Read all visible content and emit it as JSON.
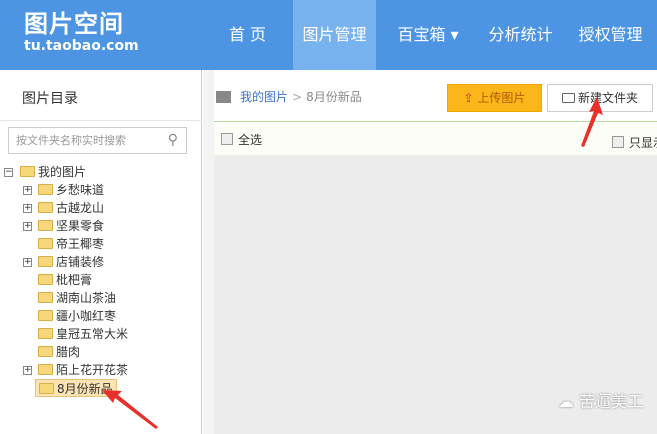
{
  "header": {
    "logo_title": "图片空间",
    "logo_url": "tu.taobao.com",
    "nav": [
      {
        "label": "首 页"
      },
      {
        "label": "图片管理",
        "active": true
      },
      {
        "label": "百宝箱 ▾"
      },
      {
        "label": "分析统计"
      },
      {
        "label": "授权管理"
      }
    ]
  },
  "sidebar": {
    "title": "图片目录",
    "search_placeholder": "按文件夹名称实时搜索",
    "root": "我的图片",
    "folders": [
      {
        "label": "乡愁味道",
        "expandable": true
      },
      {
        "label": "古越龙山",
        "expandable": true
      },
      {
        "label": "坚果零食",
        "expandable": true
      },
      {
        "label": "帝王椰枣",
        "expandable": false
      },
      {
        "label": "店铺装修",
        "expandable": true
      },
      {
        "label": "枇杷膏",
        "expandable": false
      },
      {
        "label": "湖南山茶油",
        "expandable": false
      },
      {
        "label": "疆小咖红枣",
        "expandable": false
      },
      {
        "label": "皇冠五常大米",
        "expandable": false
      },
      {
        "label": "腊肉",
        "expandable": false
      },
      {
        "label": "陌上花开花茶",
        "expandable": true
      },
      {
        "label": "8月份新品",
        "expandable": false,
        "selected": true
      }
    ]
  },
  "main": {
    "breadcrumb": {
      "root": "我的图片",
      "sep": ">",
      "current": "8月份新品"
    },
    "upload_label": "上传图片",
    "new_folder_label": "新建文件夹",
    "select_all_label": "全选",
    "only_show_label": "只显示"
  },
  "watermark": "苦逼美工"
}
